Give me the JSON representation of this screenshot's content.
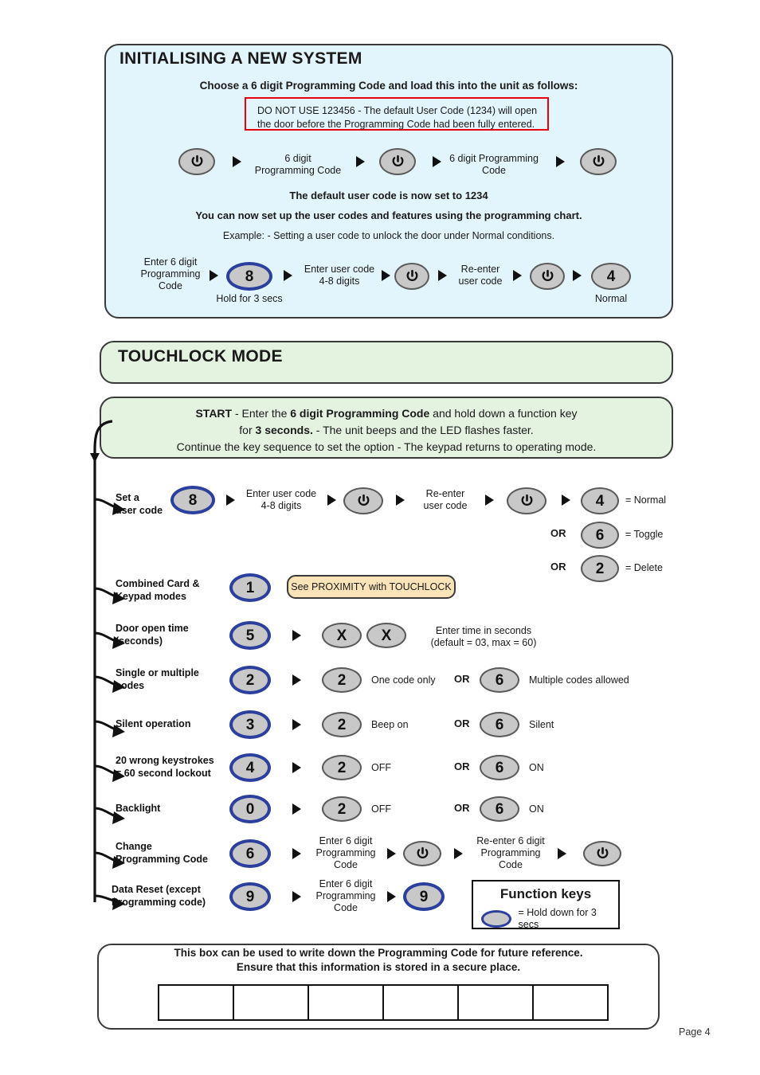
{
  "section_initialising": {
    "title": "INITIALISING A NEW SYSTEM",
    "subtitle": "Choose a 6 digit Programming Code and load this into the unit as follows:",
    "warning_line1": "DO NOT USE 123456 - The default User Code (1234) will open",
    "warning_line2": "the door before the Programming Code had been fully entered.",
    "seq_step1_label": "6 digit\nProgramming Code",
    "seq_step1_line1": "6 digit",
    "seq_step1_line2": "Programming Code",
    "seq_step2_line1": "6 digit Programming",
    "seq_step2_line2": "Code",
    "note_default_code": "The default user code is now set to 1234",
    "note_setup": "You can now set up the user codes and features using the programming chart.",
    "example_text": "Example: - Setting a user code to unlock the door under Normal conditions.",
    "example": {
      "enter_code_line1": "Enter 6 digit",
      "enter_code_line2": "Programming",
      "enter_code_line3": "Code",
      "key8": "8",
      "hold_note": "Hold for 3 secs",
      "enter_user_line1": "Enter user code",
      "enter_user_line2": "4-8 digits",
      "reenter_line1": "Re-enter",
      "reenter_line2": "user code",
      "key4": "4",
      "normal_label": "Normal"
    }
  },
  "section_touchlock": {
    "title": "TOUCHLOCK MODE",
    "start": {
      "word_start": "START",
      "line1_mid": " - Enter the ",
      "line1_bold": "6 digit Programming Code",
      "line1_end": " and hold down a function key",
      "line2_pre": "for ",
      "line2_bold": "3 seconds.",
      "line2_end": "  -  The unit beeps and the LED flashes faster.",
      "line3": "Continue the key sequence to set the option  -  The keypad returns to operating mode."
    },
    "rows": [
      {
        "caption_line1": "Set a",
        "caption_line2": "user code",
        "main_key": "8",
        "main_key_hold": true,
        "step_text_line1": "Enter user code",
        "step_text_line2": "4-8 digits",
        "reenter_line1": "Re-enter",
        "reenter_line2": "user code",
        "option_primary_key": "4",
        "option_primary_label": "= Normal",
        "options": [
          {
            "or": "OR",
            "key": "6",
            "label": "= Toggle"
          },
          {
            "or": "OR",
            "key": "2",
            "label": "= Delete"
          }
        ]
      },
      {
        "caption_line1": "Combined Card &",
        "caption_line2": "Keypad modes",
        "main_key": "1",
        "main_key_hold": true,
        "pill_text": "See PROXIMITY with TOUCHLOCK"
      },
      {
        "caption_line1": "Door open time",
        "caption_line2": "(seconds)",
        "main_key": "5",
        "main_key_hold": true,
        "x_keys": [
          "X",
          "X"
        ],
        "note_line1": "Enter time in seconds",
        "note_line2": "(default = 03, max = 60)"
      },
      {
        "caption_line1": "Single or multiple",
        "caption_line2": "codes",
        "main_key": "2",
        "main_key_hold": true,
        "opt_a_key": "2",
        "opt_a_label": "One code only",
        "or": "OR",
        "opt_b_key": "6",
        "opt_b_label": "Multiple codes allowed"
      },
      {
        "caption_line1": "Silent operation",
        "caption_line2": "",
        "main_key": "3",
        "main_key_hold": true,
        "opt_a_key": "2",
        "opt_a_label": "Beep on",
        "or": "OR",
        "opt_b_key": "6",
        "opt_b_label": "Silent"
      },
      {
        "caption_line1": "20 wrong keystrokes",
        "caption_line2": "= 60 second lockout",
        "main_key": "4",
        "main_key_hold": true,
        "opt_a_key": "2",
        "opt_a_label": "OFF",
        "or": "OR",
        "opt_b_key": "6",
        "opt_b_label": "ON"
      },
      {
        "caption_line1": "Backlight",
        "caption_line2": "",
        "main_key": "0",
        "main_key_hold": true,
        "opt_a_key": "2",
        "opt_a_label": "OFF",
        "or": "OR",
        "opt_b_key": "6",
        "opt_b_label": "ON"
      },
      {
        "caption_line1": "Change",
        "caption_line2": "Programming Code",
        "main_key": "6",
        "main_key_hold": true,
        "enter_line1": "Enter 6 digit",
        "enter_line2": "Programming",
        "enter_line3": "Code",
        "reenter_line1": "Re-enter 6 digit",
        "reenter_line2": "Programming",
        "reenter_line3": "Code"
      },
      {
        "caption_line1": "Data Reset (except",
        "caption_line2": "Programming code)",
        "main_key": "9",
        "main_key_hold": true,
        "enter_line1": "Enter 6 digit",
        "enter_line2": "Programming",
        "enter_line3": "Code",
        "final_key": "9"
      }
    ],
    "legend": {
      "title": "Function keys",
      "text": "= Hold down for 3 secs"
    }
  },
  "section_writedown": {
    "line1": "This box can be used to write down the Programming Code for future reference.",
    "line2": "Ensure that this information is stored in a secure place.",
    "cells": [
      "",
      "",
      "",
      "",
      "",
      ""
    ]
  },
  "footer": {
    "page": "Page  4"
  },
  "colors": {
    "blue_panel": "#e2f4fc",
    "green_panel": "#e4f2e0",
    "warning_red": "#e8000d",
    "hold_ring": "#2a3f9e",
    "key_gray": "#c8c8c8",
    "pill_peach": "#fbe3b8"
  }
}
